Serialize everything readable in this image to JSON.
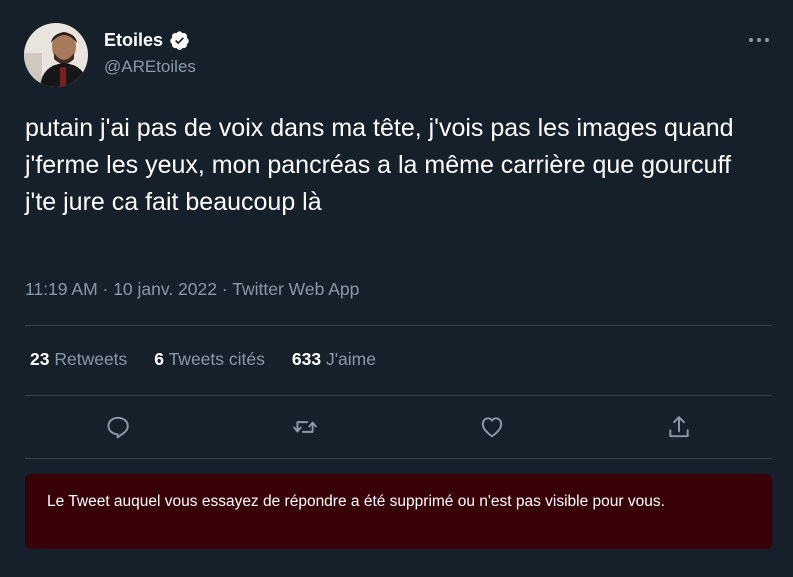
{
  "author": {
    "display_name": "Etoiles",
    "handle": "@AREtoiles",
    "verified": true,
    "avatar_icon": "profile-photo"
  },
  "tweet": {
    "text": "putain j'ai pas de voix dans ma tête, j'vois pas les images quand j'ferme les yeux, mon pancréas a la même carrière que gourcuff j'te jure ca fait beaucoup là"
  },
  "meta": {
    "time": "11:19 AM",
    "separator": " · ",
    "date": "10 janv. 2022",
    "source": "Twitter Web App"
  },
  "stats": {
    "retweets": {
      "count": "23",
      "label": "Retweets"
    },
    "quotes": {
      "count": "6",
      "label": "Tweets cités"
    },
    "likes": {
      "count": "633",
      "label": "J'aime"
    }
  },
  "actions": {
    "reply": "reply-icon",
    "retweet": "retweet-icon",
    "like": "heart-icon",
    "share": "share-icon"
  },
  "notice": {
    "text": "Le Tweet auquel vous essayez de répondre a été supprimé ou n'est pas visible pour vous."
  },
  "colors": {
    "background": "#15202b",
    "text": "#ffffff",
    "secondary": "#8b98a5",
    "divider": "#38444d",
    "notice_background": "#380007"
  }
}
